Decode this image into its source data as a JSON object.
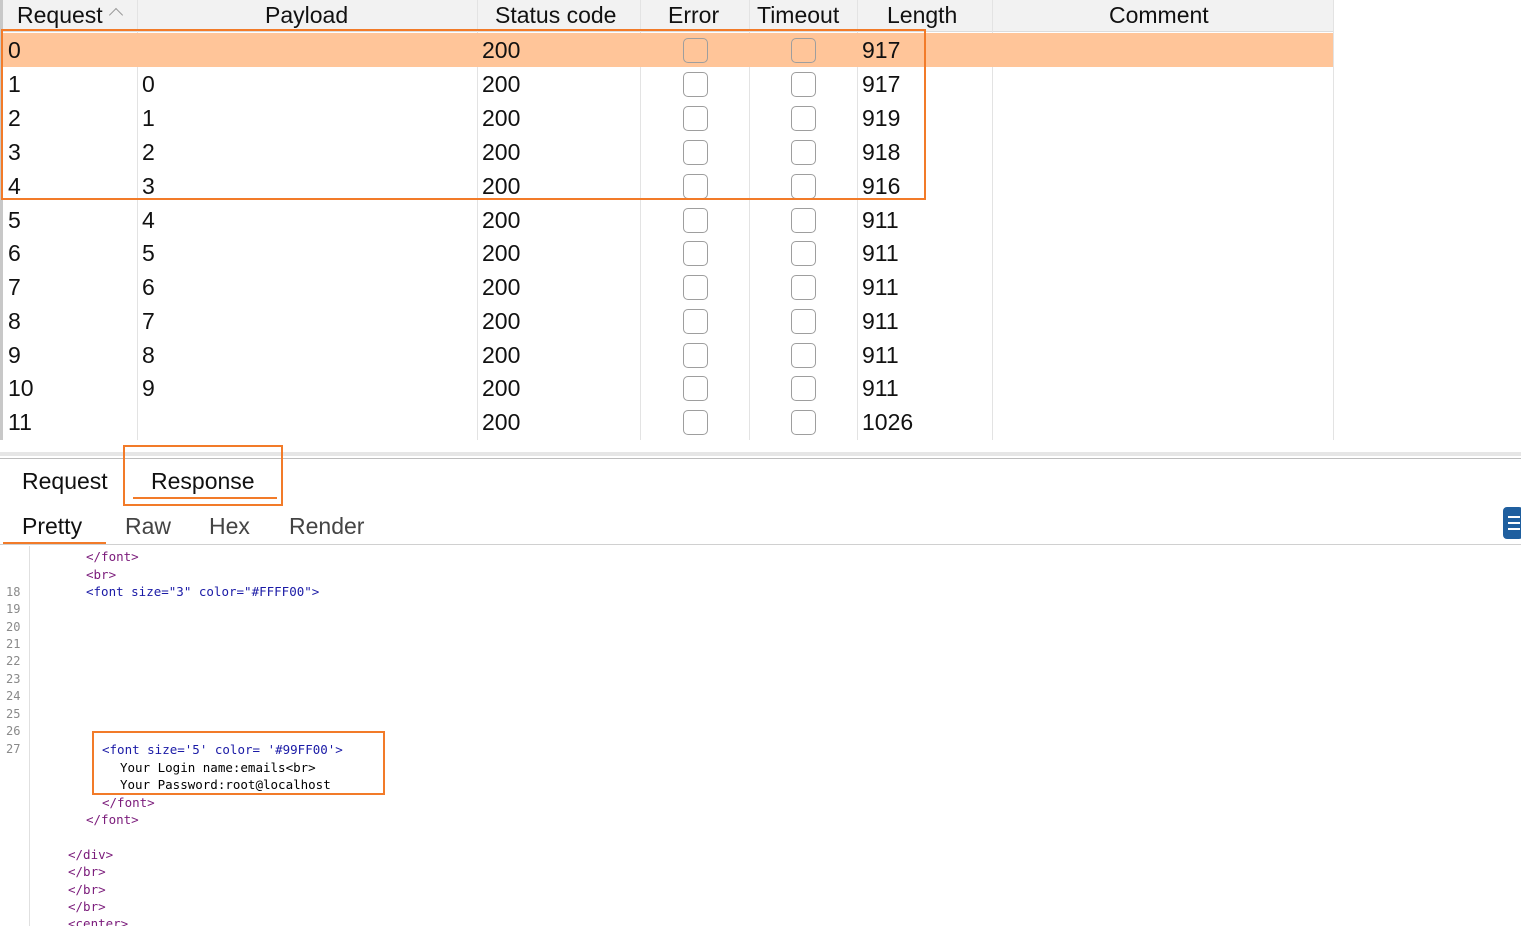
{
  "table": {
    "columns": [
      {
        "label": "Request"
      },
      {
        "label": "Payload"
      },
      {
        "label": "Status code"
      },
      {
        "label": "Error"
      },
      {
        "label": "Timeout"
      },
      {
        "label": "Length"
      },
      {
        "label": "Comment"
      }
    ],
    "rows": [
      {
        "request": "0",
        "payload": "",
        "status": "200",
        "length": "917",
        "selected": true
      },
      {
        "request": "1",
        "payload": "0",
        "status": "200",
        "length": "917"
      },
      {
        "request": "2",
        "payload": "1",
        "status": "200",
        "length": "919"
      },
      {
        "request": "3",
        "payload": "2",
        "status": "200",
        "length": "918"
      },
      {
        "request": "4",
        "payload": "3",
        "status": "200",
        "length": "916"
      },
      {
        "request": "5",
        "payload": "4",
        "status": "200",
        "length": "911"
      },
      {
        "request": "6",
        "payload": "5",
        "status": "200",
        "length": "911"
      },
      {
        "request": "7",
        "payload": "6",
        "status": "200",
        "length": "911"
      },
      {
        "request": "8",
        "payload": "7",
        "status": "200",
        "length": "911"
      },
      {
        "request": "9",
        "payload": "8",
        "status": "200",
        "length": "911"
      },
      {
        "request": "10",
        "payload": "9",
        "status": "200",
        "length": "911"
      },
      {
        "request": "11",
        "payload": "",
        "status": "200",
        "length": "1026"
      }
    ]
  },
  "tabs": {
    "request_label": "Request",
    "response_label": "Response"
  },
  "subtabs": {
    "pretty_label": "Pretty",
    "raw_label": "Raw",
    "hex_label": "Hex",
    "render_label": "Render"
  },
  "colors": {
    "selected_row": "#ffc599",
    "highlight_box": "#f27b29",
    "tab_underline": "#f27b29"
  },
  "icons": {
    "sort": "sort-ascending-icon",
    "layout": "layout-toggle-icon"
  },
  "code_viewer": {
    "line_numbers": [
      "18",
      "19",
      "20",
      "21",
      "22",
      "23",
      "24",
      "25",
      "26",
      "27"
    ],
    "lines": {
      "l1": "</font>",
      "l2": "<br>",
      "l3": "<font size=\"3\" color=\"#FFFF00\">",
      "l4": "<font size='5' color= '#99FF00'>",
      "l5": "Your Login name:emails<br>",
      "l6": "Your Password:root@localhost",
      "l7": "</font>",
      "l8": "</font>",
      "l9": "</div>",
      "l10": "</br>",
      "l11": "</br>",
      "l12": "</br>",
      "l13": "<center>"
    }
  }
}
